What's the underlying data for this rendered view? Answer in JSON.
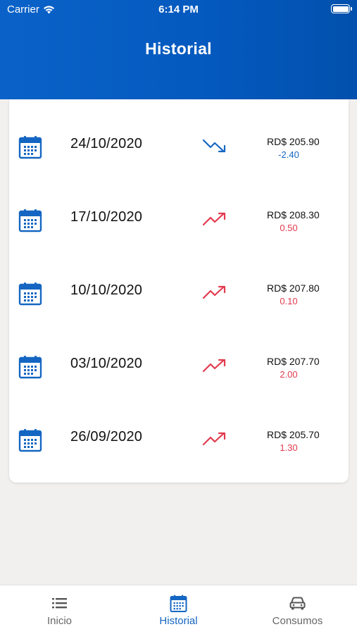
{
  "status_bar": {
    "carrier": "Carrier",
    "time": "6:14 PM"
  },
  "header": {
    "title": "Historial"
  },
  "colors": {
    "primary": "#0459be",
    "down": "#1466c2",
    "up": "#e23a4e",
    "background": "#f1f0ee"
  },
  "history": [
    {
      "date": "24/10/2020",
      "price": "RD$ 205.90",
      "change": "-2.40",
      "trend": "down"
    },
    {
      "date": "17/10/2020",
      "price": "RD$ 208.30",
      "change": "0.50",
      "trend": "up"
    },
    {
      "date": "10/10/2020",
      "price": "RD$ 207.80",
      "change": "0.10",
      "trend": "up"
    },
    {
      "date": "03/10/2020",
      "price": "RD$ 207.70",
      "change": "2.00",
      "trend": "up"
    },
    {
      "date": "26/09/2020",
      "price": "RD$ 205.70",
      "change": "1.30",
      "trend": "up"
    }
  ],
  "tabbar": {
    "items": [
      {
        "label": "Inicio",
        "icon": "list-icon",
        "active": false
      },
      {
        "label": "Historial",
        "icon": "calendar-icon",
        "active": true
      },
      {
        "label": "Consumos",
        "icon": "car-icon",
        "active": false
      }
    ]
  }
}
